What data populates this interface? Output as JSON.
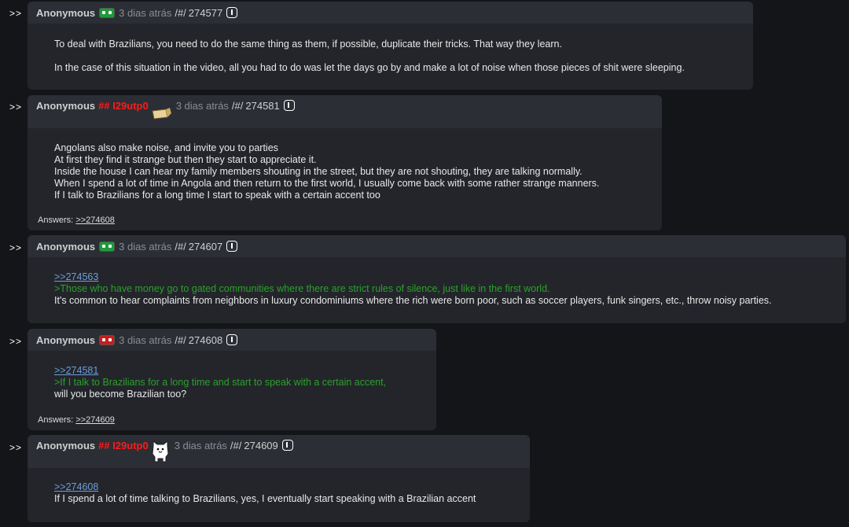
{
  "prefix": ">>",
  "posts": [
    {
      "author": "Anonymous",
      "trip": "",
      "time": "3 dias atrás",
      "sep": "/#/",
      "id": "274577",
      "lines": [
        "To deal with Brazilians, you need to do the same thing as them, if possible, duplicate their tricks. That way they learn.",
        "In the case of this situation in the video, all you had to do was let the days go by and make a lot of noise when those pieces of shit were sleeping."
      ]
    },
    {
      "author": "Anonymous",
      "trip": "## I29utp0",
      "time": "3 dias atrás",
      "sep": "/#/",
      "id": "274581",
      "lines": [
        "Angolans also make noise, and invite you to parties",
        "At first they find it strange but then they start to appreciate it.",
        "Inside the house I can hear my family members shouting in the street, but they are not shouting, they are talking normally.",
        "When I spend a lot of time in Angola and then return to the first world, I usually come back with some rather strange manners.",
        "If I talk to Brazilians for a long time I start to speak with a certain accent too"
      ],
      "answers_label": "Answers:",
      "answers": ">>274608"
    },
    {
      "author": "Anonymous",
      "trip": "",
      "time": "3 dias atrás",
      "sep": "/#/",
      "id": "274607",
      "quote_link": ">>274563",
      "greentext": ">Those who have money go to gated communities where there are strict rules of silence, just like in the first world.",
      "text": "It's common to hear complaints from neighbors in luxury condominiums where the rich were born poor, such as soccer players, funk singers, etc., throw noisy parties."
    },
    {
      "author": "Anonymous",
      "trip": "",
      "time": "3 dias atrás",
      "sep": "/#/",
      "id": "274608",
      "quote_link": ">>274581",
      "greentext": ">If I talk to Brazilians for a long time and start to speak with a certain accent,",
      "text": "will you become Brazilian too?",
      "answers_label": "Answers:",
      "answers": ">>274609"
    },
    {
      "author": "Anonymous",
      "trip": "## I29utp0",
      "time": "3 dias atrás",
      "sep": "/#/",
      "id": "274609",
      "quote_link": ">>274608",
      "text": "If I spend a lot of time talking to Brazilians, yes, I eventually start speaking with a Brazilian accent"
    }
  ],
  "colors": {
    "background": "#141519",
    "post_bg": "#23252b",
    "header_bg": "#2b2e34",
    "trip": "#ff1a1a",
    "greentext": "#2aa12a",
    "link": "#6d9ed8"
  }
}
